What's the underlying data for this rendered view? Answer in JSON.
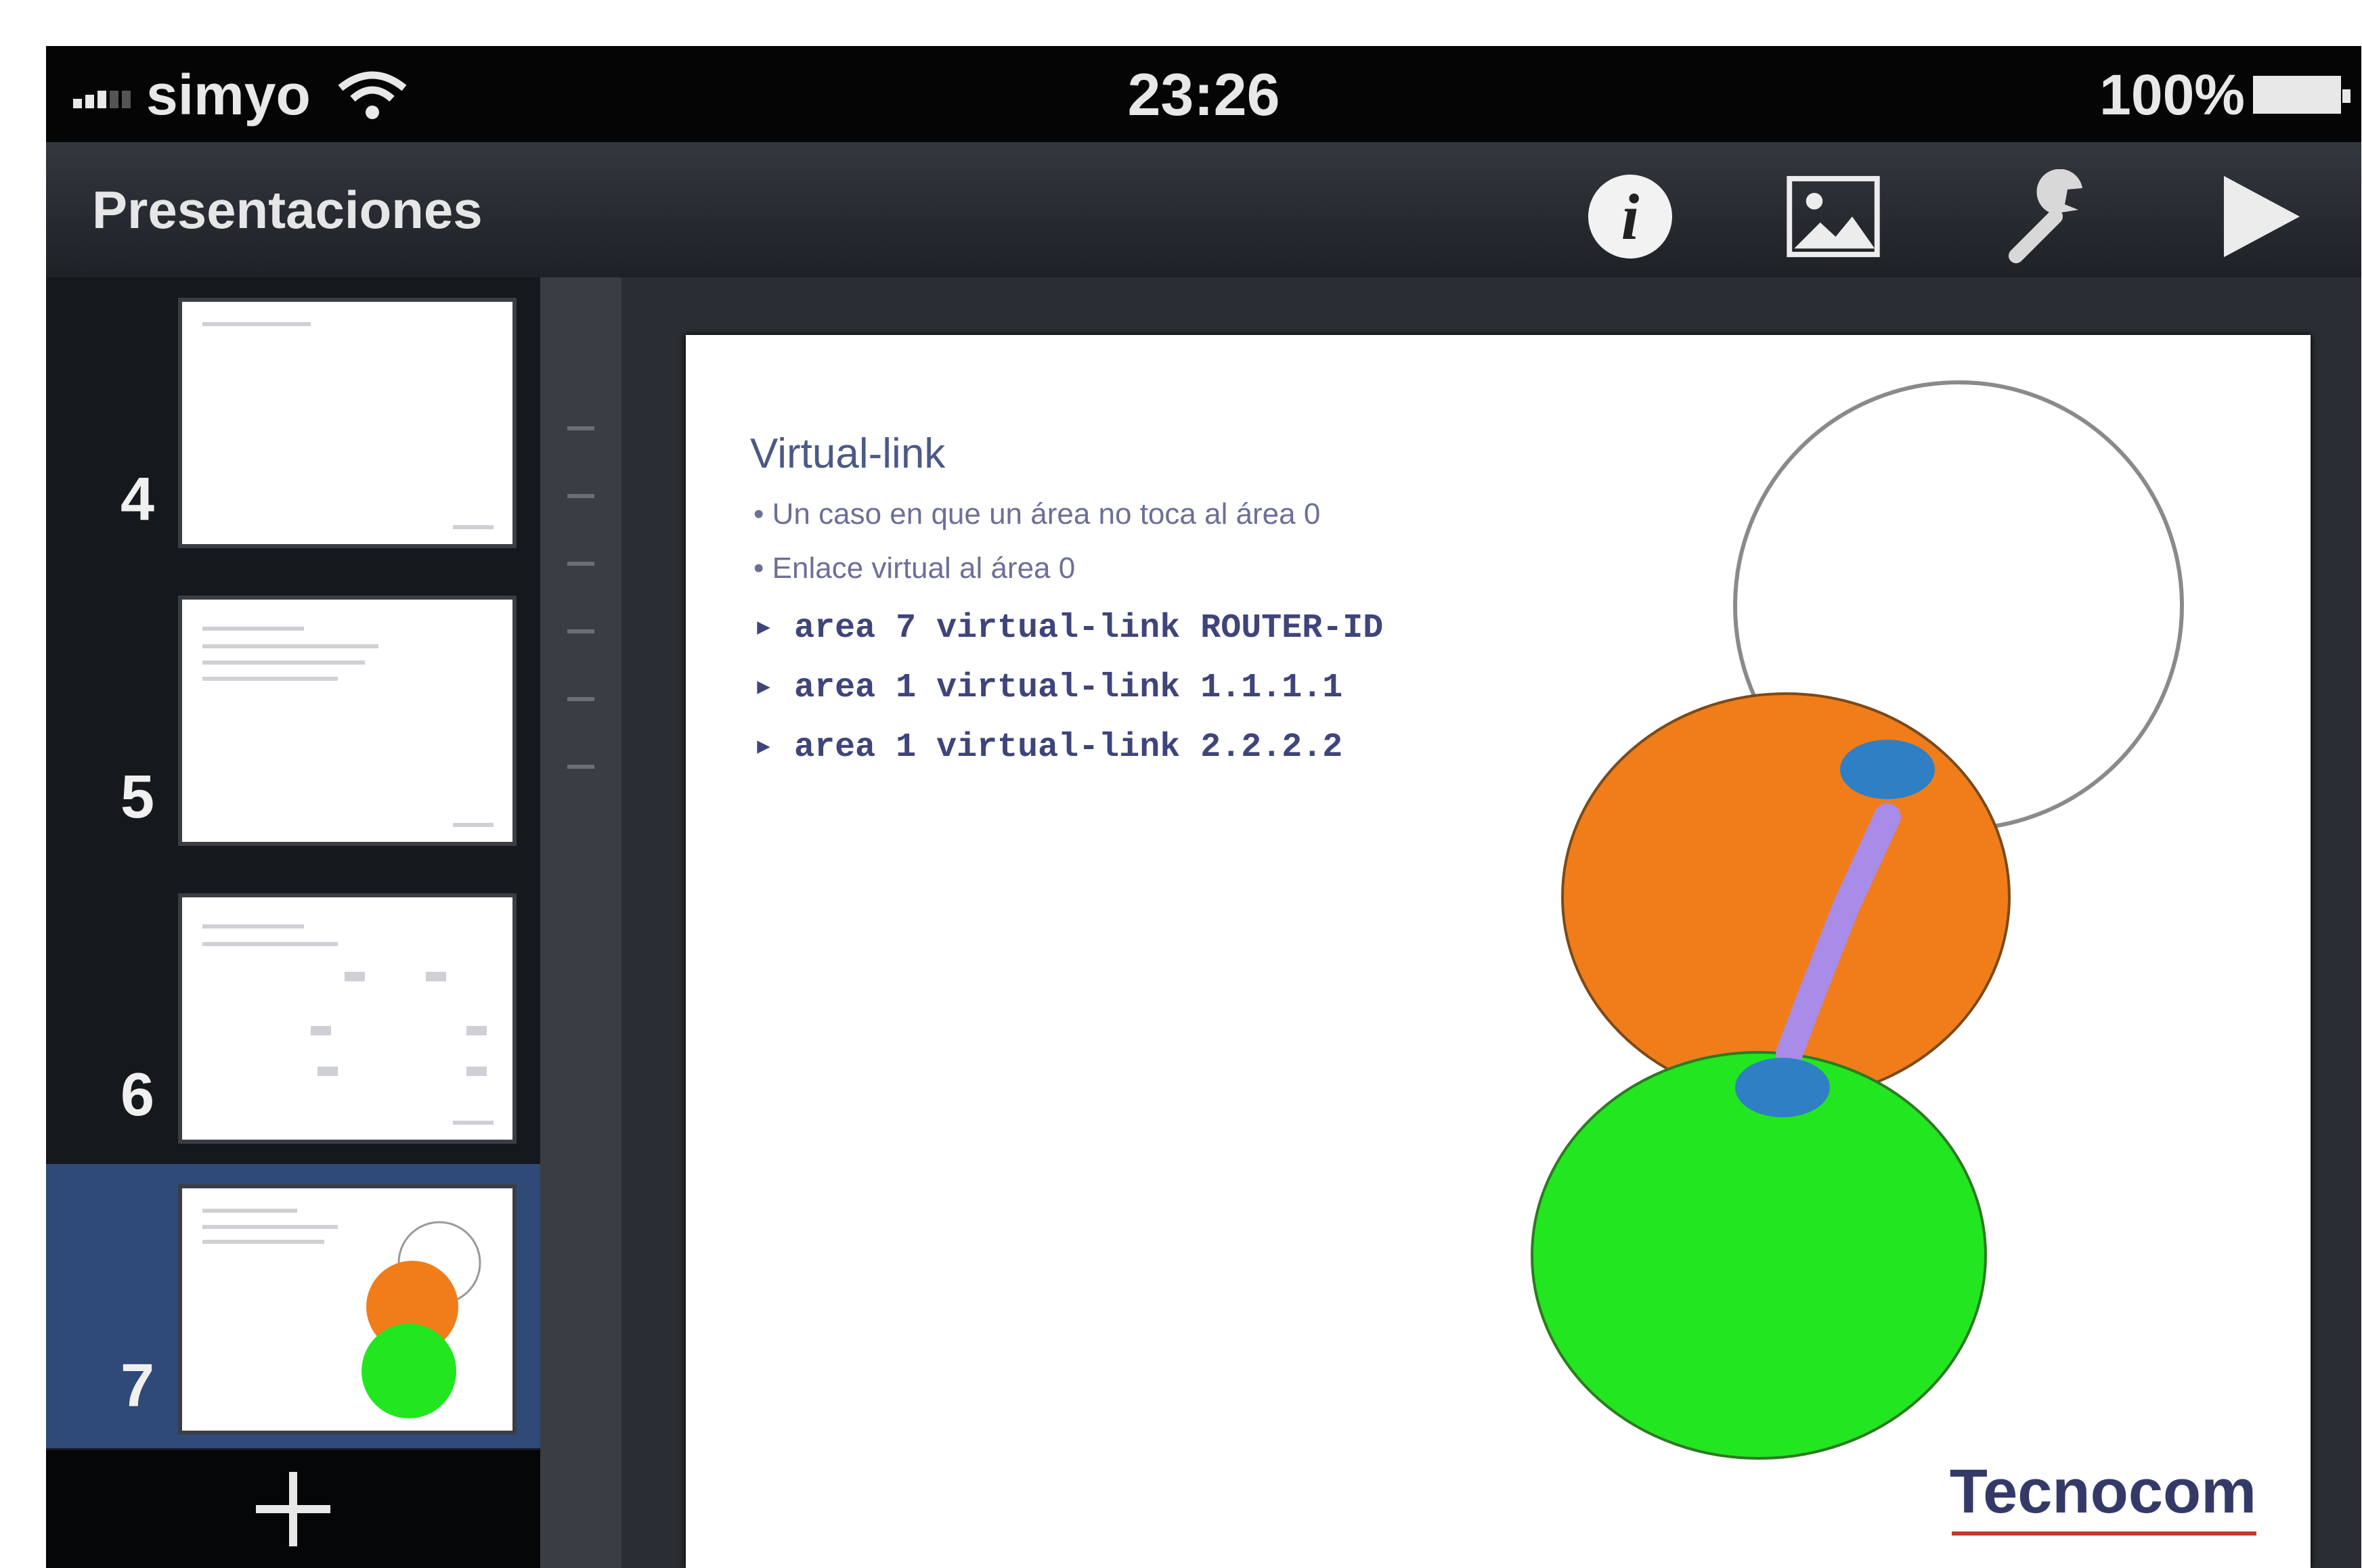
{
  "status_bar": {
    "carrier": "simyo",
    "time": "23:26",
    "battery": "100%"
  },
  "toolbar": {
    "title": "Presentaciones",
    "info_glyph": "i",
    "icons": [
      "info-icon",
      "media-icon",
      "wrench-icon",
      "play-icon"
    ]
  },
  "slides_panel": {
    "numbers": [
      "4",
      "5",
      "6",
      "7"
    ],
    "selected": "7",
    "add_icon": "plus-icon"
  },
  "slide": {
    "title": "Virtual-link",
    "bullets": [
      "Un caso en que un área no toca al área 0",
      "Enlace virtual al área 0"
    ],
    "code_lines": [
      "area 7 virtual-link ROUTER-ID",
      "area 1 virtual-link 1.1.1.1",
      "area 1 virtual-link 2.2.2.2"
    ],
    "logo": "Tecnocom"
  },
  "colors": {
    "area_white": "#ffffff",
    "area_orange": "#f07d1a",
    "area_green": "#22e61f",
    "virtual_link": "#a98be8",
    "router": "#2f7fc4",
    "selection": "#2f4a78"
  }
}
